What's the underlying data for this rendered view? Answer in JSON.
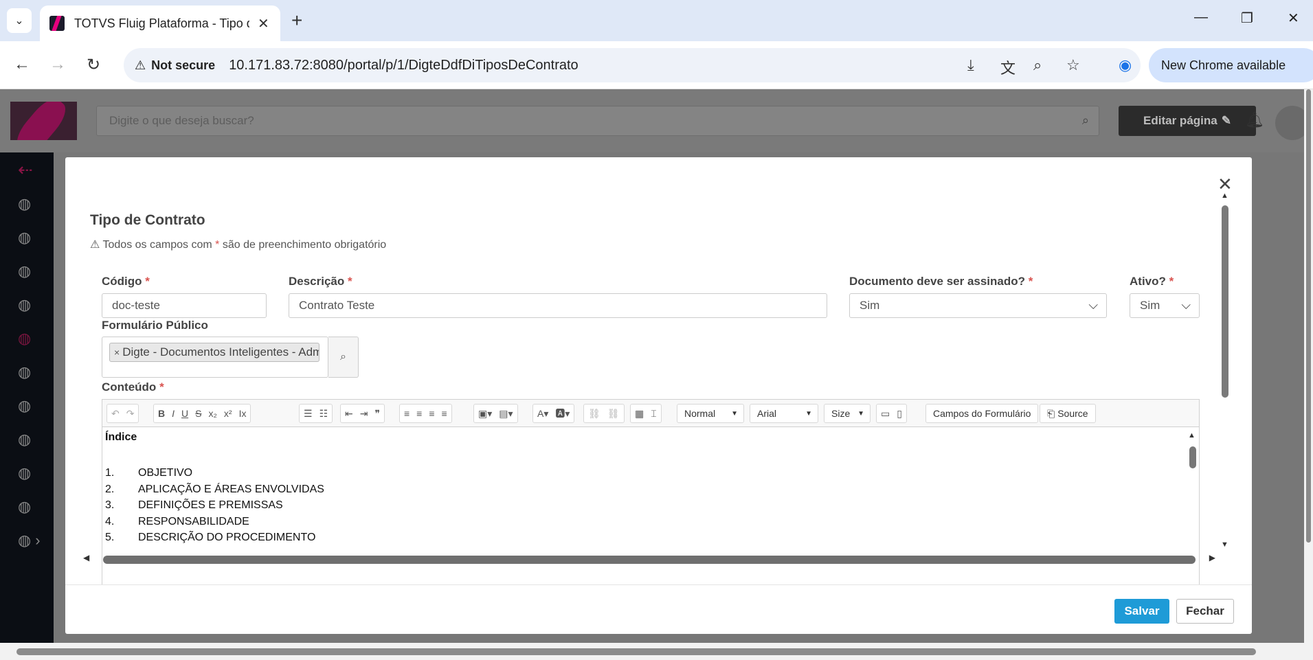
{
  "browser": {
    "tab_title": "TOTVS Fluig Plataforma - Tipo d",
    "security_label": "Not secure",
    "url": "10.171.83.72:8080/portal/p/1/DigteDdfDiTiposDeContrato",
    "update_label": "New Chrome available"
  },
  "app": {
    "search_placeholder": "Digite o que deseja buscar?",
    "edit_page_label": "Editar página"
  },
  "modal": {
    "title": "Tipo de Contrato",
    "hint_prefix": "Todos os campos com",
    "hint_star": "*",
    "hint_suffix": "são de preenchimento obrigatório",
    "fields": {
      "codigo": {
        "label": "Código",
        "value": "doc-teste"
      },
      "descricao": {
        "label": "Descrição",
        "value": "Contrato Teste"
      },
      "assinado": {
        "label": "Documento deve ser assinado?",
        "value": "Sim"
      },
      "ativo": {
        "label": "Ativo?",
        "value": "Sim"
      },
      "formulario": {
        "label": "Formulário Público",
        "tag": "Digte - Documentos Inteligentes - Admi"
      },
      "conteudo": {
        "label": "Conteúdo"
      }
    },
    "required_mark": "*",
    "editor": {
      "format_select": "Normal",
      "font_select": "Arial",
      "size_select": "Size",
      "form_fields_button": "Campos do Formulário",
      "source_button": "Source",
      "heading": "Índice",
      "items": [
        {
          "num": "1.",
          "text": "OBJETIVO"
        },
        {
          "num": "2.",
          "text": "APLICAÇÃO E ÁREAS ENVOLVIDAS"
        },
        {
          "num": "3.",
          "text": "DEFINIÇÕES E PREMISSAS"
        },
        {
          "num": "4.",
          "text": "RESPONSABILIDADE"
        },
        {
          "num": "5.",
          "text": "DESCRIÇÃO DO PROCEDIMENTO"
        }
      ]
    },
    "footer": {
      "save_label": "Salvar",
      "close_label": "Fechar"
    }
  },
  "colors": {
    "primary_button": "#1e9bd7",
    "required": "#d9534f",
    "brand": "#e6007e"
  }
}
